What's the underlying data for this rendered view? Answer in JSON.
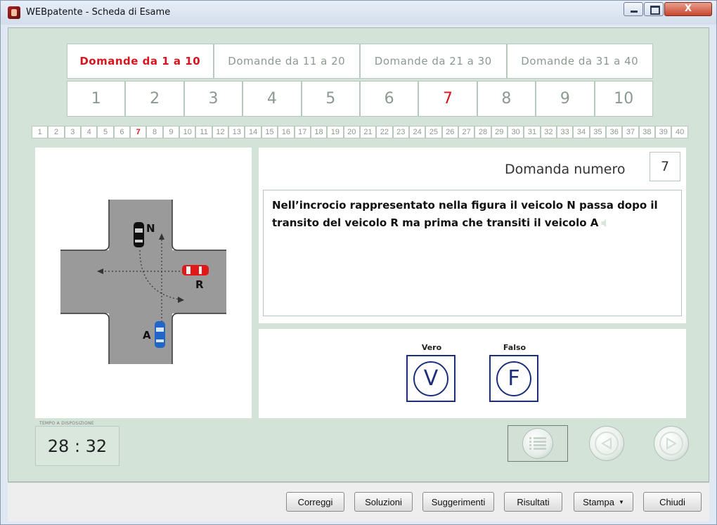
{
  "window": {
    "title": "WEBpatente - Scheda di Esame",
    "close_glyph": "X"
  },
  "range_tabs": [
    "Domande  da 1 a 10",
    "Domande  da 11 a 20",
    "Domande  da 21 a 30",
    "Domande  da 31 a 40"
  ],
  "active_range_tab": 0,
  "question_buttons": [
    "1",
    "2",
    "3",
    "4",
    "5",
    "6",
    "7",
    "8",
    "9",
    "10"
  ],
  "active_question_button": 6,
  "question_strip": [
    "1",
    "2",
    "3",
    "4",
    "5",
    "6",
    "7",
    "8",
    "9",
    "10",
    "11",
    "12",
    "13",
    "14",
    "15",
    "16",
    "17",
    "18",
    "19",
    "20",
    "21",
    "22",
    "23",
    "24",
    "25",
    "26",
    "27",
    "28",
    "29",
    "30",
    "31",
    "32",
    "33",
    "34",
    "35",
    "36",
    "37",
    "38",
    "39",
    "40"
  ],
  "active_strip": 6,
  "figure": {
    "vehicle_labels": [
      "N",
      "R",
      "A"
    ]
  },
  "question": {
    "label": "Domanda numero",
    "number": "7",
    "text": "Nell’incrocio rappresentato nella figura il veicolo N passa dopo il transito del veicolo R ma prima che transiti il veicolo A"
  },
  "answers": {
    "true_label": "Vero",
    "true_glyph": "V",
    "false_label": "Falso",
    "false_glyph": "F"
  },
  "timer": {
    "label": "TEMPO A DISPOSIZIONE",
    "value": "28 : 32"
  },
  "footer_buttons": {
    "correggi": "Correggi",
    "soluzioni": "Soluzioni",
    "suggerimenti": "Suggerimenti",
    "risultati": "Risultati",
    "stampa": "Stampa",
    "chiudi": "Chiudi"
  },
  "colors": {
    "client_bg": "#d3e3d8",
    "active_red": "#d6161e",
    "inactive_gray": "#8b9a90",
    "answer_blue": "#1c2f7a"
  },
  "icons": [
    "app-icon",
    "minimize-icon",
    "maximize-icon",
    "close-icon",
    "speaker-icon",
    "list-icon",
    "prev-arrow-icon",
    "next-arrow-icon",
    "dropdown-caret-icon"
  ]
}
